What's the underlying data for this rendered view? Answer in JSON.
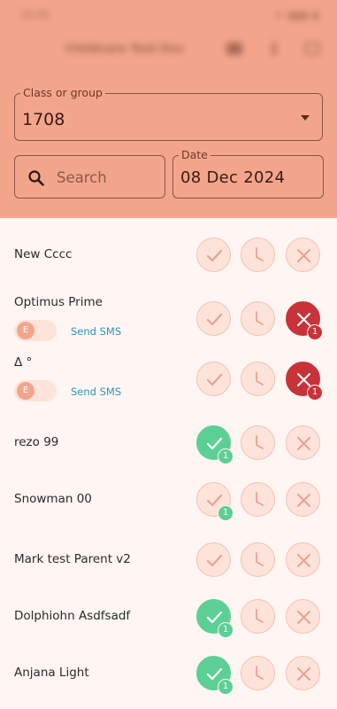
{
  "header": {
    "status_time": "10:45",
    "status_icons": "⁕ ▮▮▮ ▮",
    "app_title": "Childcare Test Env"
  },
  "filters": {
    "class_label": "Class or group",
    "class_value": "1708",
    "search_placeholder": "Search",
    "date_label": "Date",
    "date_value": "08 Dec 2024"
  },
  "colors": {
    "header_bg": "#f3a58c",
    "present": "#5ccf94",
    "absent": "#c8333a",
    "idle_button": "#fde3da",
    "sms_link": "#2a95b8"
  },
  "students": [
    {
      "name": "New Cccc",
      "status": "none",
      "badge": "",
      "sms": false
    },
    {
      "name": "Optimus Prime",
      "status": "absent",
      "badge": "1",
      "sms": true,
      "toggle": "E",
      "sms_label": "Send SMS"
    },
    {
      "name": "Δ °",
      "status": "absent",
      "badge": "1",
      "sms": true,
      "toggle": "E",
      "sms_label": "Send SMS"
    },
    {
      "name": "rezo 99",
      "status": "present",
      "badge": "1",
      "sms": false
    },
    {
      "name": "Snowman 00",
      "status": "present-idle",
      "badge": "1",
      "sms": false
    },
    {
      "name": "Mark test Parent v2",
      "status": "none",
      "badge": "",
      "sms": false
    },
    {
      "name": "Dolphiohn Asdfsadf",
      "status": "present",
      "badge": "1",
      "sms": false
    },
    {
      "name": "Anjana Light",
      "status": "present",
      "badge": "1",
      "sms": false
    }
  ]
}
